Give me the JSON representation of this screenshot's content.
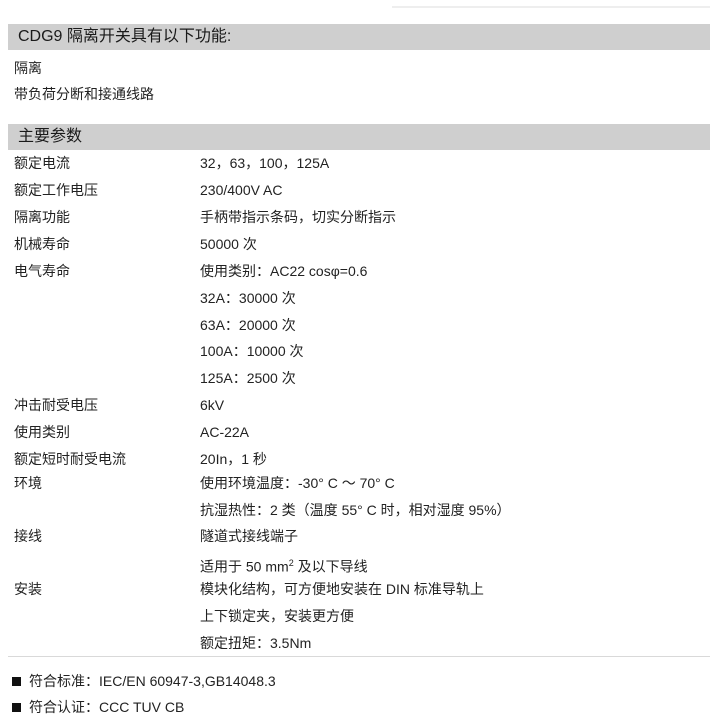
{
  "section1": {
    "title": "CDG9 隔离开关具有以下功能:",
    "items": [
      "隔离",
      "带负荷分断和接通线路"
    ]
  },
  "section2": {
    "title": "主要参数",
    "rows": [
      {
        "label": "额定电流",
        "value": "32，63，100，125A"
      },
      {
        "label": "额定工作电压",
        "value": "230/400V AC"
      },
      {
        "label": "隔离功能",
        "value": "手柄带指示条码，切实分断指示"
      },
      {
        "label": "机械寿命",
        "value": "50000 次"
      },
      {
        "label": "电气寿命",
        "value": "使用类别：AC22 cosφ=0.6"
      },
      {
        "label": "",
        "value": "32A：30000 次"
      },
      {
        "label": "",
        "value": "63A：20000 次"
      },
      {
        "label": "",
        "value": "100A：10000 次"
      },
      {
        "label": "",
        "value": "125A：2500 次"
      },
      {
        "label": "冲击耐受电压",
        "value": "6kV"
      },
      {
        "label": "使用类别",
        "value": "AC-22A"
      },
      {
        "label": "额定短时耐受电流",
        "value": "20In，1 秒"
      },
      {
        "label": "环境",
        "value": "使用环境温度：-30° C ～ 70° C"
      },
      {
        "label": "",
        "value": "抗湿热性：2 类（温度 55° C 时，相对湿度 95%）"
      },
      {
        "label": "接线",
        "value": "隧道式接线端子"
      },
      {
        "label": "",
        "value_pre": "适用于 50 mm",
        "value_sup": "2",
        "value_post": " 及以下导线"
      },
      {
        "label": "安装",
        "value": "模块化结构，可方便地安装在 DIN 标准导轨上"
      },
      {
        "label": "",
        "value": "上下锁定夹，安装更方便"
      },
      {
        "label": "",
        "value": "额定扭矩：3.5Nm"
      }
    ]
  },
  "footer": {
    "items": [
      "符合标准：IEC/EN 60947-3,GB14048.3",
      "符合认证：CCC TUV  CB"
    ]
  }
}
